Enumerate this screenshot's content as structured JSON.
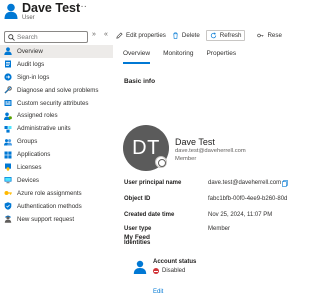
{
  "header": {
    "title": "Dave Test",
    "subtitle": "User",
    "more": "···"
  },
  "search": {
    "placeholder": "Search"
  },
  "collapse": {
    "expand_glyph": "»",
    "collapse_glyph": "«"
  },
  "sidebar": {
    "items": [
      {
        "label": "Overview",
        "icon": "user-icon",
        "active": true
      },
      {
        "label": "Audit logs",
        "icon": "log-icon"
      },
      {
        "label": "Sign-in logs",
        "icon": "signin-icon"
      },
      {
        "label": "Diagnose and solve problems",
        "icon": "wrench-icon"
      },
      {
        "label": "Custom security attributes",
        "icon": "attribute-icon"
      },
      {
        "label": "Assigned roles",
        "icon": "roles-icon"
      },
      {
        "label": "Administrative units",
        "icon": "admin-units-icon"
      },
      {
        "label": "Groups",
        "icon": "groups-icon"
      },
      {
        "label": "Applications",
        "icon": "apps-icon"
      },
      {
        "label": "Licenses",
        "icon": "license-icon"
      },
      {
        "label": "Devices",
        "icon": "device-icon"
      },
      {
        "label": "Azure role assignments",
        "icon": "key-icon"
      },
      {
        "label": "Authentication methods",
        "icon": "shield-icon"
      },
      {
        "label": "New support request",
        "icon": "support-icon"
      }
    ]
  },
  "toolbar": {
    "edit_label": "Edit properties",
    "delete_label": "Delete",
    "refresh_label": "Refresh",
    "reset_label": "Rese"
  },
  "tabs": {
    "overview": "Overview",
    "monitoring": "Monitoring",
    "properties": "Properties"
  },
  "basic_info": {
    "title": "Basic info",
    "initials": "DT",
    "display_name": "Dave Test",
    "email": "dave.test@daveherrell.com",
    "role": "Member"
  },
  "properties": {
    "upn_label": "User principal name",
    "upn_value": "dave.test@daveherrell.com",
    "object_id_label": "Object ID",
    "object_id_value": "fabc1bfb-00f0-4ee9-b260-80d",
    "created_label": "Created date time",
    "created_value": "Nov 25, 2024, 11:07 PM",
    "user_type_label": "User type",
    "user_type_value": "Member",
    "identities_label": "Identities"
  },
  "feed": {
    "title": "My Feed",
    "card_title": "Account status",
    "status": "Disabled",
    "edit_link": "Edit"
  },
  "colors": {
    "accent": "#0078d4",
    "status_disabled": "#d13438",
    "avatar_bg": "#5b5b5b"
  }
}
